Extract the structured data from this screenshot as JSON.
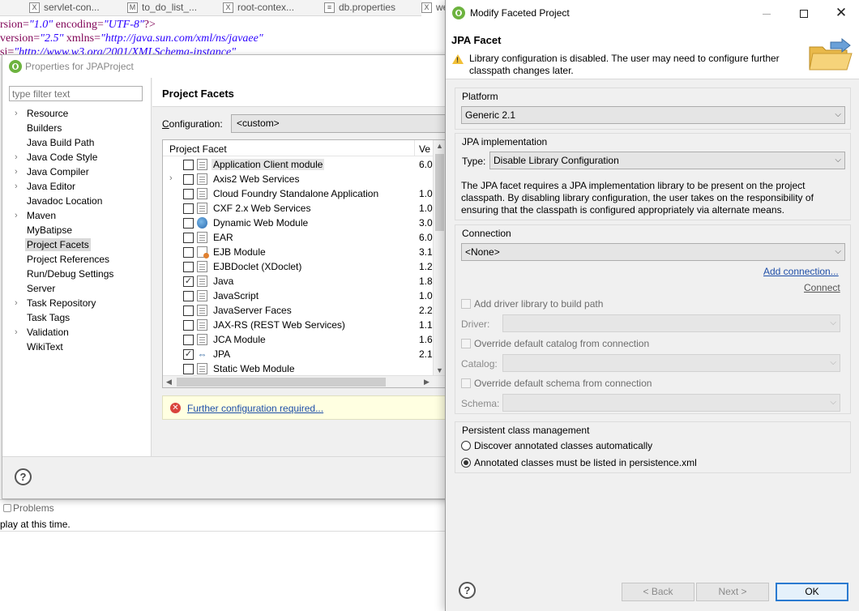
{
  "editor": {
    "tabs": [
      {
        "label": "servlet-con...",
        "icon": "X"
      },
      {
        "label": "to_do_list_...",
        "icon": "M"
      },
      {
        "label": "root-contex...",
        "icon": "X"
      },
      {
        "label": "db.properties",
        "icon": "≡"
      },
      {
        "label": "we",
        "icon": "X"
      }
    ],
    "code": {
      "l1_a": "rsion=",
      "l1_b": "\"1.0\"",
      "l1_c": " encoding=",
      "l1_d": "\"UTF-8\"",
      "l1_e": "?>",
      "l2_a": " version=",
      "l2_b": "\"2.5\"",
      "l2_c": " xmlns=",
      "l2_d": "\"http://java.sun.com/xml/ns/javaee\"",
      "l3_a": "si=",
      "l3_b": "\"http://www.w3.org/2001/XMLSchema-instance\""
    },
    "problems_label": "Problems",
    "problems_text": "play at this time."
  },
  "properties_dialog": {
    "title": "Properties for JPAProject",
    "filter_placeholder": "type filter text",
    "nav_items": [
      {
        "label": "Resource",
        "expandable": true
      },
      {
        "label": "Builders",
        "expandable": false
      },
      {
        "label": "Java Build Path",
        "expandable": false
      },
      {
        "label": "Java Code Style",
        "expandable": true
      },
      {
        "label": "Java Compiler",
        "expandable": true
      },
      {
        "label": "Java Editor",
        "expandable": true
      },
      {
        "label": "Javadoc Location",
        "expandable": false
      },
      {
        "label": "Maven",
        "expandable": true
      },
      {
        "label": "MyBatipse",
        "expandable": false
      },
      {
        "label": "Project Facets",
        "expandable": false,
        "selected": true
      },
      {
        "label": "Project References",
        "expandable": false
      },
      {
        "label": "Run/Debug Settings",
        "expandable": false
      },
      {
        "label": "Server",
        "expandable": false
      },
      {
        "label": "Task Repository",
        "expandable": true
      },
      {
        "label": "Task Tags",
        "expandable": false
      },
      {
        "label": "Validation",
        "expandable": true
      },
      {
        "label": "WikiText",
        "expandable": false
      }
    ],
    "page_title": "Project Facets",
    "config_label_u": "C",
    "config_label_rest": "onfiguration:",
    "config_value": "<custom>",
    "facet_col": "Project Facet",
    "version_col": "Ve",
    "facets": [
      {
        "name": "Application Client module",
        "version": "6.0",
        "checked": false,
        "icon": "page",
        "selected": true
      },
      {
        "name": "Axis2 Web Services",
        "version": "",
        "checked": false,
        "icon": "page",
        "expandable": true
      },
      {
        "name": "Cloud Foundry Standalone Application",
        "version": "1.0",
        "checked": false,
        "icon": "page"
      },
      {
        "name": "CXF 2.x Web Services",
        "version": "1.0",
        "checked": false,
        "icon": "page"
      },
      {
        "name": "Dynamic Web Module",
        "version": "3.0",
        "checked": false,
        "icon": "globe"
      },
      {
        "name": "EAR",
        "version": "6.0",
        "checked": false,
        "icon": "page"
      },
      {
        "name": "EJB Module",
        "version": "3.1",
        "checked": false,
        "icon": "gear"
      },
      {
        "name": "EJBDoclet (XDoclet)",
        "version": "1.2",
        "checked": false,
        "icon": "page"
      },
      {
        "name": "Java",
        "version": "1.8",
        "checked": true,
        "icon": "page"
      },
      {
        "name": "JavaScript",
        "version": "1.0",
        "checked": false,
        "icon": "page"
      },
      {
        "name": "JavaServer Faces",
        "version": "2.2",
        "checked": false,
        "icon": "page"
      },
      {
        "name": "JAX-RS (REST Web Services)",
        "version": "1.1",
        "checked": false,
        "icon": "page"
      },
      {
        "name": "JCA Module",
        "version": "1.6",
        "checked": false,
        "icon": "page"
      },
      {
        "name": "JPA",
        "version": "2.1",
        "checked": true,
        "icon": "jpa"
      },
      {
        "name": "Static Web Module",
        "version": "",
        "checked": false,
        "icon": "page"
      }
    ],
    "further_link": "Further configuration required...",
    "help_glyph": "?"
  },
  "modify_dialog": {
    "title": "Modify Faceted Project",
    "header_title": "JPA Facet",
    "warning": "Library configuration is disabled. The user may need to configure further classpath changes later.",
    "platform_label": "Platform",
    "platform_value": "Generic 2.1",
    "impl_label": "JPA implementation",
    "type_label": "Type:",
    "type_value": "Disable Library Configuration",
    "description": "The JPA facet requires a JPA implementation library to be present on the project classpath. By disabling library configuration, the user takes on the responsibility of ensuring that the classpath is configured appropriately via alternate means.",
    "connection_label": "Connection",
    "connection_value": "<None>",
    "add_connection": "Add connection...",
    "connect": "Connect",
    "add_driver": "Add driver library to build path",
    "driver_label": "Driver:",
    "override_catalog": "Override default catalog from connection",
    "catalog_label": "Catalog:",
    "override_schema": "Override default schema from connection",
    "schema_label": "Schema:",
    "pcm_label": "Persistent class management",
    "radio_discover": "Discover annotated classes automatically",
    "radio_listed": "Annotated classes must be listed in persistence.xml",
    "selected_radio": "listed",
    "back_button": "< Back",
    "next_button": "Next >",
    "ok_button": "OK",
    "help_glyph": "?",
    "close_glyph": "✕",
    "dropdown_glyph": "⌵"
  }
}
